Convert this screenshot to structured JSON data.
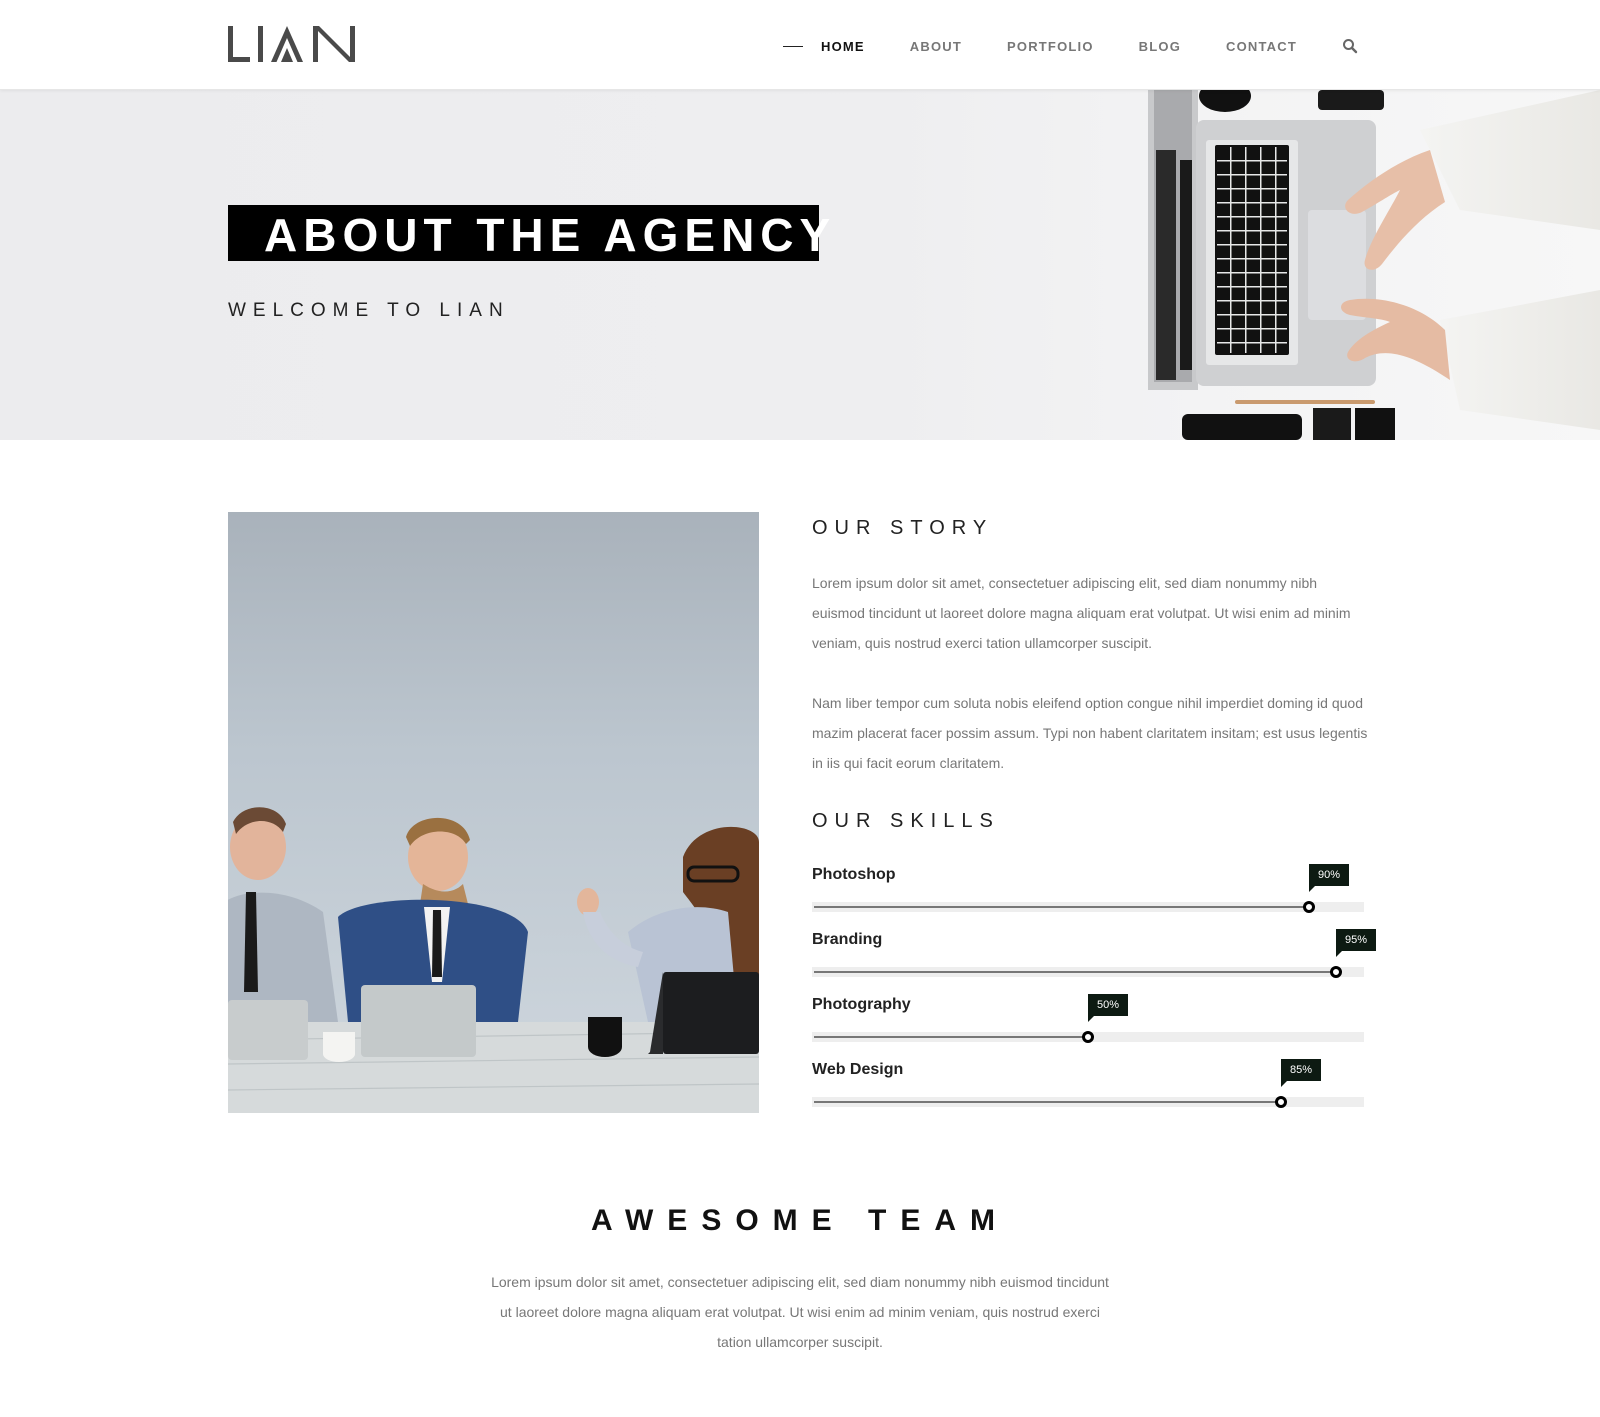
{
  "header": {
    "logo_text": "LIAN",
    "nav": [
      {
        "label": "HOME",
        "active": true
      },
      {
        "label": "ABOUT",
        "active": false
      },
      {
        "label": "PORTFOLIO",
        "active": false
      },
      {
        "label": "BLOG",
        "active": false
      },
      {
        "label": "CONTACT",
        "active": false
      }
    ],
    "search_icon": "search-icon"
  },
  "hero": {
    "title": "ABOUT THE AGENCY",
    "subtitle": "WELCOME TO LIAN"
  },
  "story": {
    "title": "OUR STORY",
    "paragraphs": [
      "Lorem ipsum dolor sit amet, consectetuer adipiscing elit, sed diam nonummy nibh euismod tincidunt ut laoreet dolore magna aliquam erat volutpat. Ut wisi enim ad minim veniam, quis nostrud exerci tation ullamcorper suscipit.",
      "Nam liber tempor cum soluta nobis eleifend option congue nihil imperdiet doming id quod mazim placerat facer possim assum. Typi non habent claritatem insitam; est usus legentis in iis qui facit eorum claritatem."
    ]
  },
  "skills": {
    "title": "OUR SKILLS",
    "items": [
      {
        "label": "Photoshop",
        "percent": 90,
        "display": "90%"
      },
      {
        "label": "Branding",
        "percent": 95,
        "display": "95%"
      },
      {
        "label": "Photography",
        "percent": 50,
        "display": "50%"
      },
      {
        "label": "Web Design",
        "percent": 85,
        "display": "85%"
      }
    ]
  },
  "team": {
    "title": "AWESOME TEAM",
    "text": "Lorem ipsum dolor sit amet, consectetuer adipiscing elit, sed diam nonummy nibh euismod tincidunt ut laoreet dolore magna aliquam erat volutpat. Ut wisi enim ad minim veniam, quis nostrud exerci tation ullamcorper suscipit."
  },
  "colors": {
    "accent": "#000000",
    "text_muted": "#777777",
    "tag_bg": "#0d1a12"
  }
}
